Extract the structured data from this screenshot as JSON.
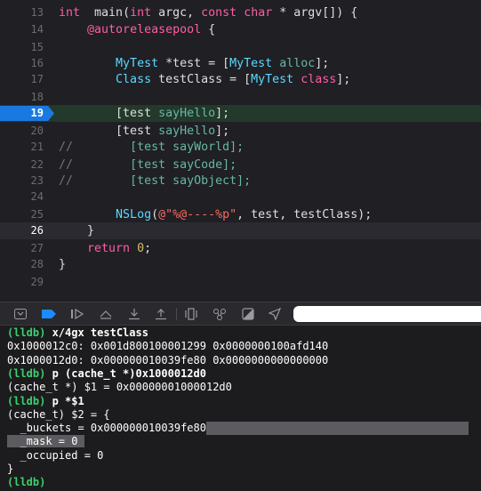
{
  "editor": {
    "lines": [
      {
        "num": "13",
        "parts": [
          [
            "kw",
            "int"
          ],
          [
            "",
            "  main("
          ],
          [
            "kw",
            "int"
          ],
          [
            "",
            " argc, "
          ],
          [
            "kw",
            "const"
          ],
          [
            "",
            " "
          ],
          [
            "kw",
            "char"
          ],
          [
            "",
            " * argv[]) {"
          ]
        ]
      },
      {
        "num": "14",
        "parts": [
          [
            "",
            "    "
          ],
          [
            "kw",
            "@autoreleasepool"
          ],
          [
            "",
            " {"
          ]
        ]
      },
      {
        "num": "15",
        "parts": []
      },
      {
        "num": "16",
        "parts": [
          [
            "",
            "        "
          ],
          [
            "cls",
            "MyTest"
          ],
          [
            "",
            " *test = ["
          ],
          [
            "cls",
            "MyTest"
          ],
          [
            "",
            " "
          ],
          [
            "fn",
            "alloc"
          ],
          [
            "",
            "];"
          ]
        ]
      },
      {
        "num": "17",
        "parts": [
          [
            "",
            "        "
          ],
          [
            "cls",
            "Class"
          ],
          [
            "",
            " testClass = ["
          ],
          [
            "cls",
            "MyTest"
          ],
          [
            "",
            " "
          ],
          [
            "kw",
            "class"
          ],
          [
            "",
            "];"
          ]
        ]
      },
      {
        "num": "18",
        "parts": []
      },
      {
        "num": "19",
        "parts": [
          [
            "",
            "        [test "
          ],
          [
            "fn",
            "sayHello"
          ],
          [
            "",
            "];"
          ]
        ]
      },
      {
        "num": "20",
        "parts": [
          [
            "",
            "        [test "
          ],
          [
            "fn",
            "sayHello"
          ],
          [
            "",
            "];"
          ]
        ]
      },
      {
        "num": "21",
        "parts": [
          [
            "cmt",
            "//"
          ],
          [
            "",
            "        "
          ],
          [
            "sel",
            "[test sayWorld];"
          ]
        ]
      },
      {
        "num": "22",
        "parts": [
          [
            "cmt",
            "//"
          ],
          [
            "",
            "        "
          ],
          [
            "sel",
            "[test sayCode];"
          ]
        ]
      },
      {
        "num": "23",
        "parts": [
          [
            "cmt",
            "//"
          ],
          [
            "",
            "        "
          ],
          [
            "sel",
            "[test sayObject];"
          ]
        ]
      },
      {
        "num": "24",
        "parts": []
      },
      {
        "num": "25",
        "parts": [
          [
            "",
            "        "
          ],
          [
            "cls",
            "NSLog"
          ],
          [
            "",
            "("
          ],
          [
            "str",
            "@\"%@----%p\""
          ],
          [
            "",
            ", test, testClass);"
          ]
        ]
      },
      {
        "num": "26",
        "parts": [
          [
            "",
            "    }"
          ]
        ]
      },
      {
        "num": "27",
        "parts": [
          [
            "",
            "    "
          ],
          [
            "kw",
            "return"
          ],
          [
            "",
            " "
          ],
          [
            "num-lit",
            "0"
          ],
          [
            "",
            ";"
          ]
        ]
      },
      {
        "num": "28",
        "parts": [
          [
            "",
            "}"
          ]
        ]
      },
      {
        "num": "29",
        "parts": []
      }
    ]
  },
  "debug_bar": {
    "icons": [
      "hide-console-icon",
      "breakpoints-toggle-icon",
      "continue-icon",
      "step-over-icon",
      "step-into-icon",
      "step-out-icon",
      "debug-view-hierarchy-icon",
      "memory-graph-icon",
      "environment-overrides-icon",
      "simulate-location-icon"
    ]
  },
  "console": {
    "lines": [
      {
        "prompt": "(lldb)",
        "text": " x/4gx testClass",
        "bold": true
      },
      {
        "prompt": "",
        "text": "0x1000012c0: 0x001d800100001299 0x0000000100afd140"
      },
      {
        "prompt": "",
        "text": "0x1000012d0: 0x000000010039fe80 0x0000000000000000"
      },
      {
        "prompt": "(lldb)",
        "text": " p (cache_t *)0x1000012d0",
        "bold": true
      },
      {
        "prompt": "",
        "text": "(cache_t *) $1 = 0x00000001000012d0"
      },
      {
        "prompt": "(lldb)",
        "text": " p *$1",
        "bold": true
      },
      {
        "prompt": "",
        "text": "(cache_t) $2 = {"
      },
      {
        "prompt": "",
        "text": "  _buckets = 0x000000010039fe80",
        "highlight": "tail"
      },
      {
        "prompt": "",
        "text": "  _mask = 0",
        "highlight": "full"
      },
      {
        "prompt": "",
        "text": "  _occupied = 0"
      },
      {
        "prompt": "",
        "text": "}"
      },
      {
        "prompt": "(lldb)",
        "text": ""
      }
    ]
  }
}
